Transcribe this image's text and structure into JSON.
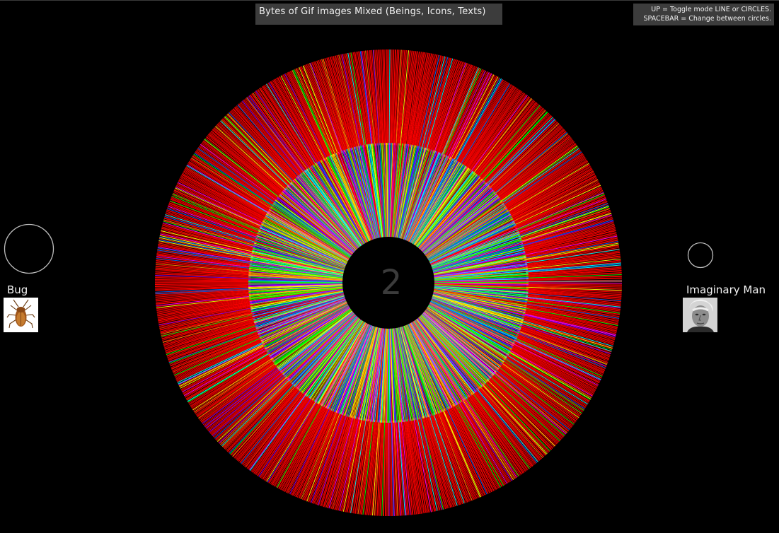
{
  "title": "Bytes of Gif images Mixed (Beings, Icons, Texts)",
  "help": {
    "line1": "UP = Toggle mode LINE or CIRCLES.",
    "line2": "SPACEBAR = Change between circles."
  },
  "center_number": "2",
  "left_item": {
    "label": "Bug",
    "icon": "cockroach-icon"
  },
  "right_item": {
    "label": "Imaginary Man",
    "icon": "elderly-man-portrait"
  },
  "colors": {
    "background": "#000000",
    "outer_dominant": "#ff0000",
    "accents": [
      "#ff0000",
      "#ff2200",
      "#ffff00",
      "#00ff00",
      "#0066ff",
      "#8800ff",
      "#ff00ff",
      "#00ffff",
      "#ff8800"
    ]
  }
}
